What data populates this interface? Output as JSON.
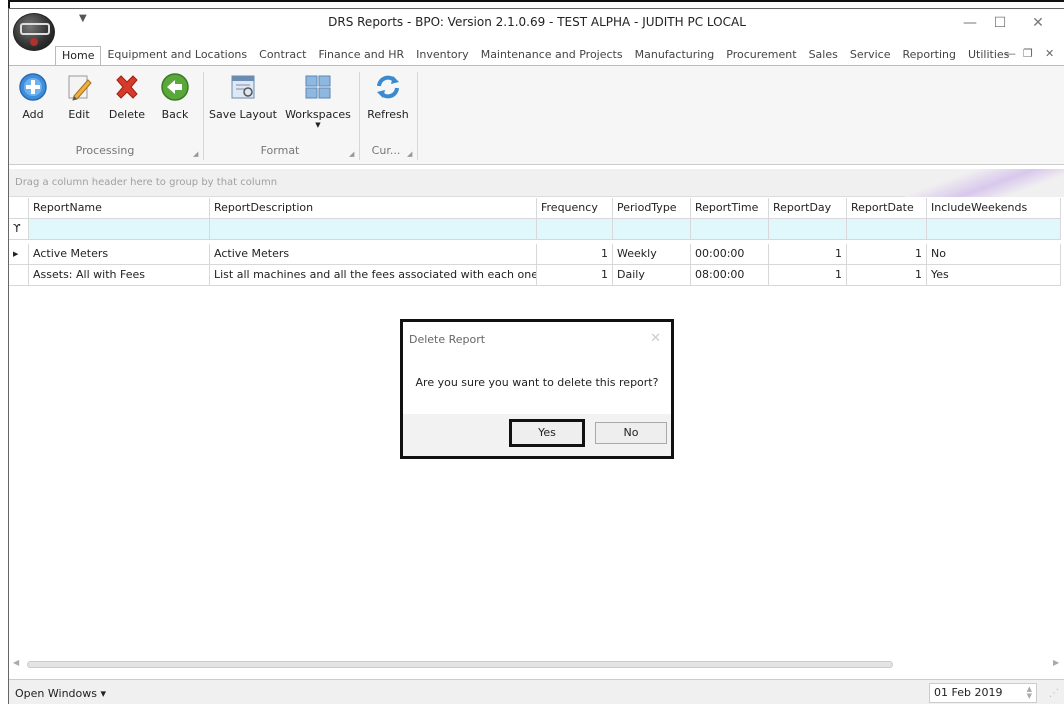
{
  "window": {
    "title": "DRS Reports - BPO: Version 2.1.0.69 - TEST ALPHA - JUDITH PC LOCAL",
    "logo_text": "BPO",
    "qat_glyph": "▼",
    "minimize": "—",
    "maximize": "☐",
    "close": "✕"
  },
  "ribbon": {
    "tabs": [
      "Home",
      "Equipment and Locations",
      "Contract",
      "Finance and HR",
      "Inventory",
      "Maintenance and Projects",
      "Manufacturing",
      "Procurement",
      "Sales",
      "Service",
      "Reporting",
      "Utilities"
    ],
    "tab_ctrl": {
      "collapse": "—",
      "restore": "❐",
      "close": "✕"
    },
    "buttons": {
      "add": "Add",
      "edit": "Edit",
      "delete": "Delete",
      "back": "Back",
      "save_layout": "Save Layout",
      "workspaces": "Workspaces",
      "refresh": "Refresh"
    },
    "groups": {
      "processing": "Processing",
      "format": "Format",
      "currency": "Cur..."
    }
  },
  "grid": {
    "group_hint": "Drag a column header here to group by that column",
    "filter_icon": "ϒ",
    "row_indicator": "▶",
    "columns": [
      "ReportName",
      "ReportDescription",
      "Frequency",
      "PeriodType",
      "ReportTime",
      "ReportDay",
      "ReportDate",
      "IncludeWeekends"
    ],
    "rows": [
      {
        "name": "Active Meters",
        "description": "Active Meters",
        "frequency": "1",
        "period_type": "Weekly",
        "time": "00:00:00",
        "day": "1",
        "date": "1",
        "weekends": "No"
      },
      {
        "name": "Assets: All with Fees",
        "description": "List all machines and all the fees associated with each one",
        "frequency": "1",
        "period_type": "Daily",
        "time": "08:00:00",
        "day": "1",
        "date": "1",
        "weekends": "Yes"
      }
    ]
  },
  "dialog": {
    "title": "Delete Report",
    "close": "✕",
    "message": "Are you sure you want to delete this report?",
    "yes": "Yes",
    "no": "No"
  },
  "status": {
    "open_windows": "Open Windows ▾",
    "date": "01 Feb 2019",
    "grip": "⋰"
  },
  "colors": {
    "filter_row": "#e0f7fb",
    "delete_red": "#d63a2a",
    "add_blue": "#3f8edb",
    "back_green": "#5aa83a"
  }
}
